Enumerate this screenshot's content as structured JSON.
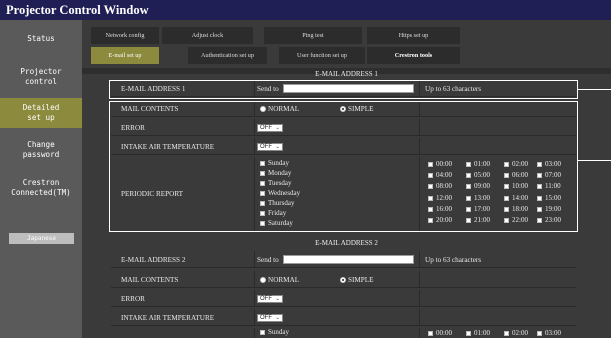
{
  "window": {
    "title": "Projector Control Window"
  },
  "sidebar": {
    "items": [
      {
        "label": "Status"
      },
      {
        "label": "Projector\ncontrol"
      },
      {
        "label": "Detailed\nset up"
      },
      {
        "label": "Change\npassword"
      },
      {
        "label": "Crestron\nConnected(TM)"
      }
    ],
    "language_button": "Japanese",
    "active_index": 2
  },
  "tabs": {
    "row1": [
      "Network config",
      "Adjust clock",
      "Ping test",
      "Https set up"
    ],
    "row2": [
      "E-mail set up",
      "Authentication set up",
      "User function set up",
      "Crestron tools"
    ],
    "active": "E-mail set up"
  },
  "section1": {
    "title": "E-MAIL ADDRESS 1",
    "address_label": "E-MAIL ADDRESS 1",
    "send_to_label": "Send to",
    "send_to_value": "",
    "limit_note": "Up to 63 characters",
    "mail_contents_label": "MAIL CONTENTS",
    "normal_label": "NORMAL",
    "simple_label": "SIMPLE",
    "mail_contents_selected": "SIMPLE",
    "error_label": "ERROR",
    "error_value": "OFF",
    "intake_label": "INTAKE AIR TEMPERATURE",
    "intake_value": "OFF",
    "periodic_label": "PERIODIC REPORT",
    "days": [
      "Sunday",
      "Monday",
      "Tuesday",
      "Wednesday",
      "Thursday",
      "Friday",
      "Saturday"
    ],
    "hours": [
      "00:00",
      "01:00",
      "02:00",
      "03:00",
      "04:00",
      "05:00",
      "06:00",
      "07:00",
      "08:00",
      "09:00",
      "10:00",
      "11:00",
      "12:00",
      "13:00",
      "14:00",
      "15:00",
      "16:00",
      "17:00",
      "18:00",
      "19:00",
      "20:00",
      "21:00",
      "22:00",
      "23:00"
    ]
  },
  "section2": {
    "title": "E-MAIL ADDRESS 2",
    "address_label": "E-MAIL ADDRESS 2",
    "send_to_label": "Send to",
    "send_to_value": "",
    "limit_note": "Up to 63 characters",
    "mail_contents_label": "MAIL CONTENTS",
    "normal_label": "NORMAL",
    "simple_label": "SIMPLE",
    "mail_contents_selected": "SIMPLE",
    "error_label": "ERROR",
    "error_value": "OFF",
    "intake_label": "INTAKE AIR TEMPERATURE",
    "intake_value": "OFF",
    "days": [
      "Sunday"
    ],
    "hours": [
      "00:00",
      "01:00",
      "02:00",
      "03:00"
    ]
  }
}
